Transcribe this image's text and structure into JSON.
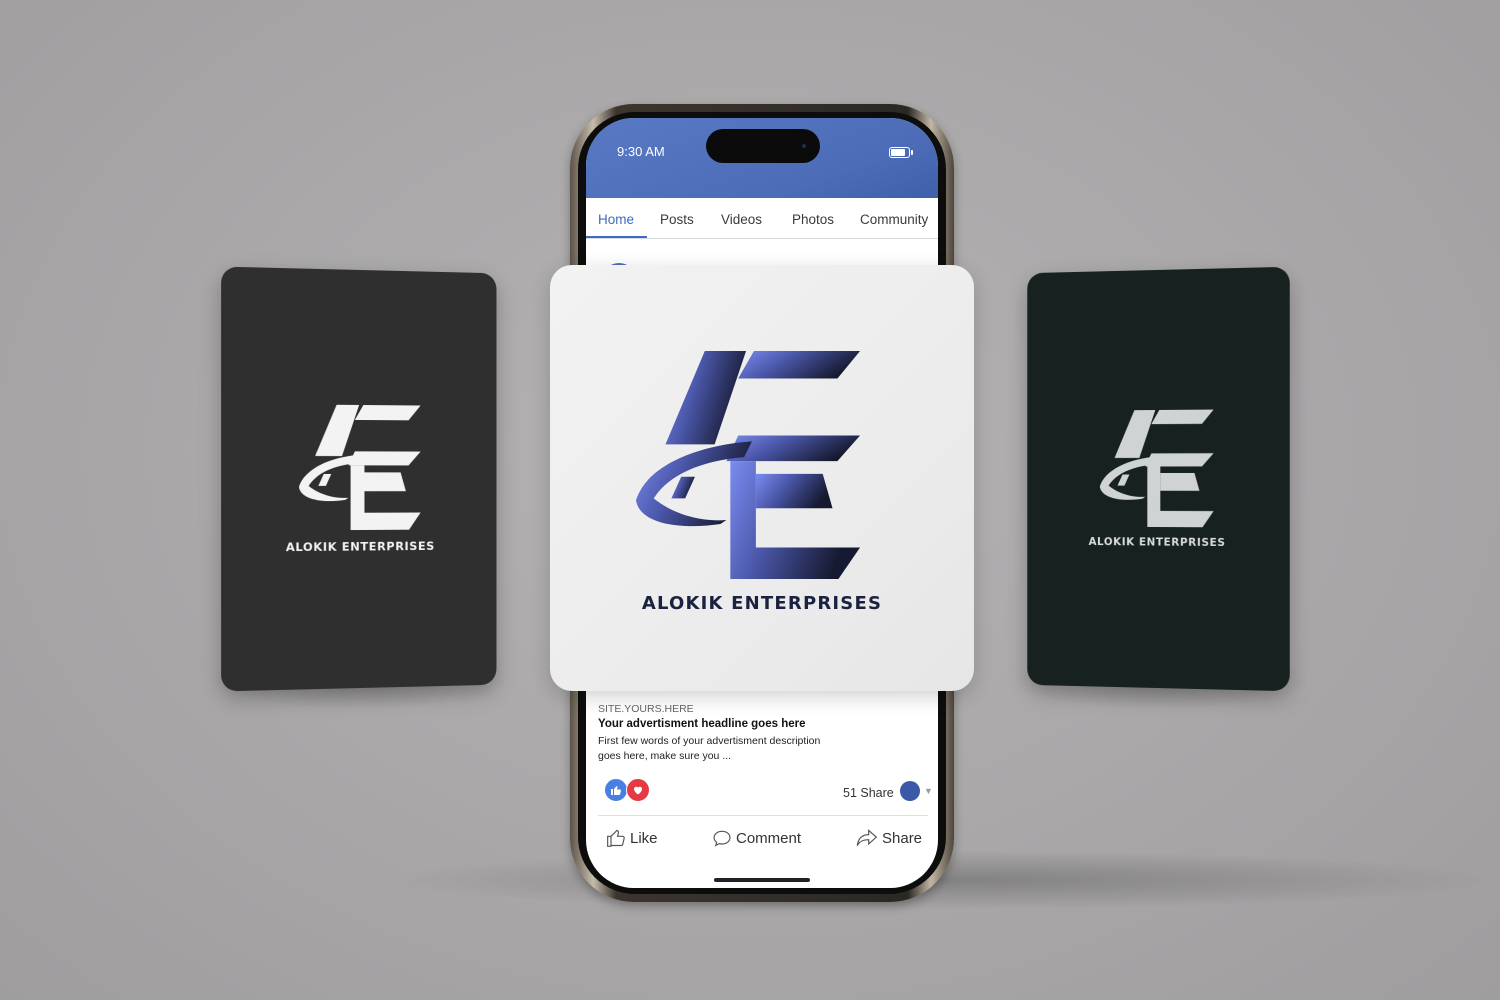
{
  "brand": {
    "name": "ALOKIK ENTERPRISES",
    "monogram_colors": [
      "#6b7fe0",
      "#1b1f3c"
    ]
  },
  "phone": {
    "status_bar": {
      "time": "9:30 AM",
      "battery_icon": "battery-icon"
    },
    "tabs": [
      {
        "label": "Home",
        "active": true
      },
      {
        "label": "Posts",
        "active": false
      },
      {
        "label": "Videos",
        "active": false
      },
      {
        "label": "Photos",
        "active": false
      },
      {
        "label": "Community",
        "active": false
      }
    ],
    "ad": {
      "site": "SITE.YOURS.HERE",
      "headline": "Your advertisment headline goes here",
      "description": "First few words of your advertisment description goes here, make sure you ..."
    },
    "reactions": {
      "icons": [
        "thumbs-up-icon",
        "heart-icon"
      ],
      "share_count": "51 Share"
    },
    "actions": [
      {
        "label": "Like",
        "icon": "thumbs-up-outline-icon"
      },
      {
        "label": "Comment",
        "icon": "comment-icon"
      },
      {
        "label": "Share",
        "icon": "share-arrow-icon"
      }
    ]
  },
  "colors": {
    "accent": "#3b6cc2",
    "header_blue": "#4c6cb8",
    "left_card": "#2f2f2f",
    "right_card": "#17211f",
    "background": "#aaa8a9"
  }
}
